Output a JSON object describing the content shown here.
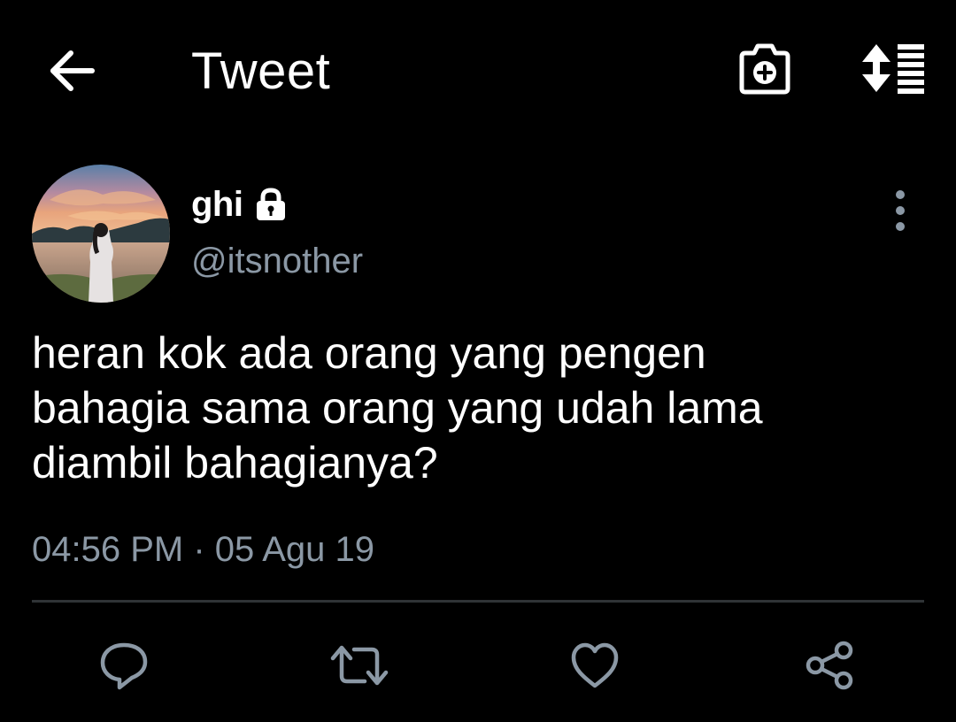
{
  "header": {
    "title": "Tweet",
    "back_icon": "arrow-left-icon",
    "camera_icon": "camera-plus-icon",
    "sort_icon": "sort-list-icon"
  },
  "author": {
    "name": "ghi",
    "handle": "@itsnother",
    "protected_icon": "lock-icon",
    "avatar": "profile-photo",
    "menu_icon": "more-vertical-icon"
  },
  "tweet": {
    "text": "heran kok ada orang yang pengen\nbahagia sama orang yang udah lama\ndiambil bahagianya?",
    "time": "04:56 PM",
    "separator": "·",
    "date": "05 Agu 19"
  },
  "actions": [
    {
      "name": "reply",
      "icon": "reply-bubble-icon"
    },
    {
      "name": "retweet",
      "icon": "retweet-icon"
    },
    {
      "name": "like",
      "icon": "heart-icon"
    },
    {
      "name": "share",
      "icon": "share-icon"
    }
  ],
  "colors": {
    "background": "#000000",
    "text_primary": "#ffffff",
    "text_secondary": "#8b98a5",
    "icon_muted": "#8b98a5",
    "divider": "#2f3336"
  }
}
